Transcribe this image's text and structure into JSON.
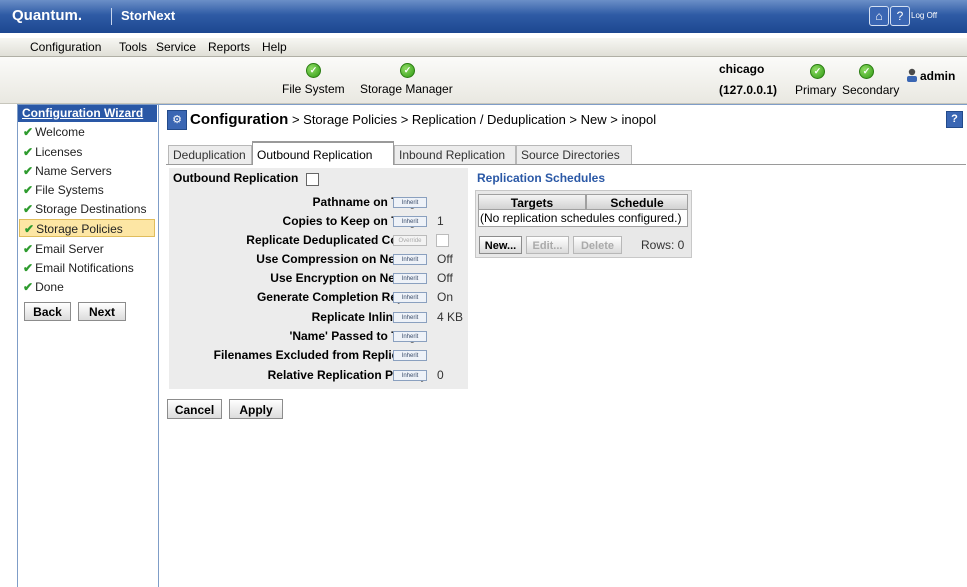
{
  "titlebar": {
    "logo": "Quantum.",
    "product": "StorNext",
    "logoff": "Log Off"
  },
  "menu": [
    "Configuration",
    "Tools",
    "Service",
    "Reports",
    "Help"
  ],
  "status": {
    "file_system": "File System",
    "storage_manager": "Storage Manager",
    "host": "chicago",
    "ip": "(127.0.0.1)",
    "primary": "Primary",
    "secondary": "Secondary",
    "user": "admin"
  },
  "wizard": {
    "title": "Configuration Wizard",
    "steps": [
      "Welcome",
      "Licenses",
      "Name Servers",
      "File Systems",
      "Storage Destinations",
      "Storage Policies",
      "Email Server",
      "Email Notifications",
      "Done"
    ],
    "back": "Back",
    "next": "Next"
  },
  "breadcrumb": {
    "root": "Configuration",
    "path": " > Storage Policies > Replication / Deduplication > New > inopol"
  },
  "tabs": [
    "Deduplication",
    "Outbound Replication",
    "Inbound Replication",
    "Source Directories"
  ],
  "outbound": {
    "title": "Outbound Replication",
    "fields": [
      {
        "label": "Pathname on Target",
        "button": "Inherit",
        "value": ""
      },
      {
        "label": "Copies to Keep on Target",
        "button": "Inherit",
        "value": "1"
      },
      {
        "label": "Replicate Deduplicated Content",
        "button": "Override",
        "value": ""
      },
      {
        "label": "Use Compression on Network",
        "button": "Inherit",
        "value": "Off"
      },
      {
        "label": "Use Encryption on Network",
        "button": "Inherit",
        "value": "Off"
      },
      {
        "label": "Generate Completion Reports",
        "button": "Inherit",
        "value": "On"
      },
      {
        "label": "Replicate Inline Size",
        "button": "Inherit",
        "value": "4 KB"
      },
      {
        "label": "'Name' Passed to Target",
        "button": "Inherit",
        "value": ""
      },
      {
        "label": "Filenames Excluded from Replication",
        "button": "Inherit",
        "value": ""
      },
      {
        "label": "Relative Replication Priority",
        "button": "Inherit",
        "value": "0"
      }
    ]
  },
  "schedules": {
    "title": "Replication Schedules",
    "col_targets": "Targets",
    "col_schedule": "Schedule",
    "empty": "(No replication schedules configured.)",
    "new": "New...",
    "edit": "Edit...",
    "delete": "Delete",
    "rows": "Rows: 0"
  },
  "actions": {
    "cancel": "Cancel",
    "apply": "Apply"
  }
}
